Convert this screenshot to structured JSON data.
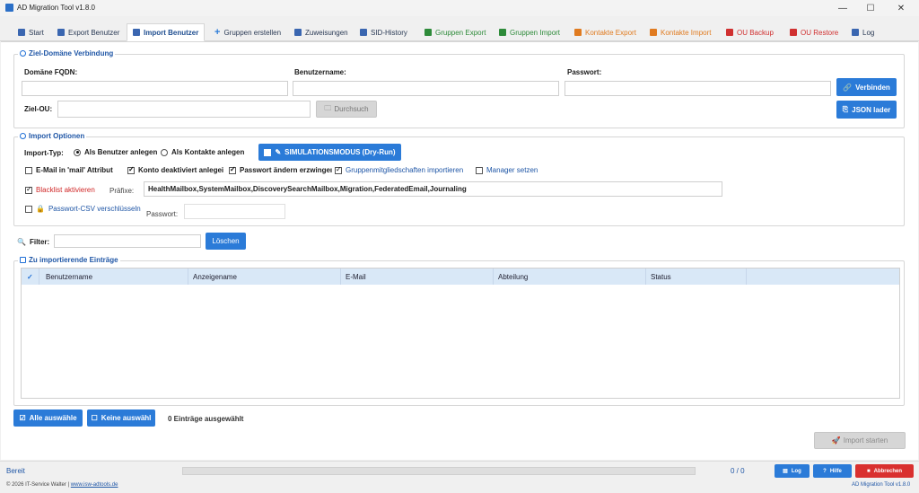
{
  "window": {
    "title": "AD Migration Tool v1.8.0",
    "minimize": "—",
    "maximize": "☐",
    "close": "✕"
  },
  "tabs": [
    {
      "label": "Start",
      "color": "#3a66b0"
    },
    {
      "label": "Export Benutzer",
      "color": "#3a66b0"
    },
    {
      "label": "Import Benutzer",
      "color": "#3a66b0"
    },
    {
      "label": "Gruppen erstellen",
      "color": "#2b7bd8"
    },
    {
      "label": "Zuweisungen",
      "color": "#3a66b0"
    },
    {
      "label": "SID-History",
      "color": "#3a66b0"
    },
    {
      "label": "Gruppen Export",
      "color": "#2e8b3a"
    },
    {
      "label": "Gruppen Import",
      "color": "#2e8b3a"
    },
    {
      "label": "Kontakte Export",
      "color": "#e07b20"
    },
    {
      "label": "Kontakte Import",
      "color": "#e07b20"
    },
    {
      "label": "OU Backup",
      "color": "#d03030"
    },
    {
      "label": "OU Restore",
      "color": "#d03030"
    },
    {
      "label": "Log",
      "color": "#3a66b0"
    }
  ],
  "connection": {
    "title": "Ziel-Domäne Verbindung",
    "domain_label": "Domäne FQDN:",
    "user_label": "Benutzername:",
    "password_label": "Passwort:",
    "domain_value": "",
    "user_value": "",
    "password_value": "",
    "ou_label": "Ziel-OU:",
    "ou_value": "",
    "browse_label": "Durchsuch",
    "connect_label": "Verbinden",
    "json_label": "JSON lader"
  },
  "options": {
    "title": "Import Optionen",
    "import_type_label": "Import-Typ:",
    "radio_users": "Als Benutzer anlegen",
    "radio_contacts": "Als Kontakte anlegen",
    "simulation_label": "SIMULATIONSMODUS (Dry-Run)",
    "cb_email": "E-Mail in 'mail' Attribut",
    "cb_disabled": "Konto deaktiviert anlegei",
    "cb_pwchange": "Passwort ändern erzwingeı",
    "cb_groups": "Gruppenmitgliedschaften importieren",
    "cb_manager": "Manager setzen",
    "cb_blacklist": "Blacklist aktivieren",
    "prefix_label": "Präfixe:",
    "prefix_value": "HealthMailbox,SystemMailbox,DiscoverySearchMailbox,Migration,FederatedEmail,Journaling",
    "cb_encrypt": "Passwort-CSV verschlüsseln",
    "pw_label": "Passwort:",
    "pw_value": ""
  },
  "filter": {
    "label": "Filter:",
    "value": "",
    "clear_label": "Löschen"
  },
  "entries": {
    "title": "Zu importierende Einträge",
    "columns": [
      "✓",
      "Benutzername",
      "Anzeigename",
      "E-Mail",
      "Abteilung",
      "Status"
    ]
  },
  "selection": {
    "select_all": "Alle auswähle",
    "select_none": "Keine auswähl",
    "count_text": "0 Einträge ausgewählt"
  },
  "import_button": "Import starten",
  "statusbar": {
    "status": "Bereit",
    "progress_text": "0 / 0",
    "progress_fraction": 0,
    "log_btn": "Log",
    "help_btn": "Hilfe",
    "cancel_btn": "Abbrechen",
    "copyright": "© 2026 IT-Service Walter |",
    "website": "www.isw-adtools.de",
    "version": "AD Migration Tool v1.8.0"
  }
}
